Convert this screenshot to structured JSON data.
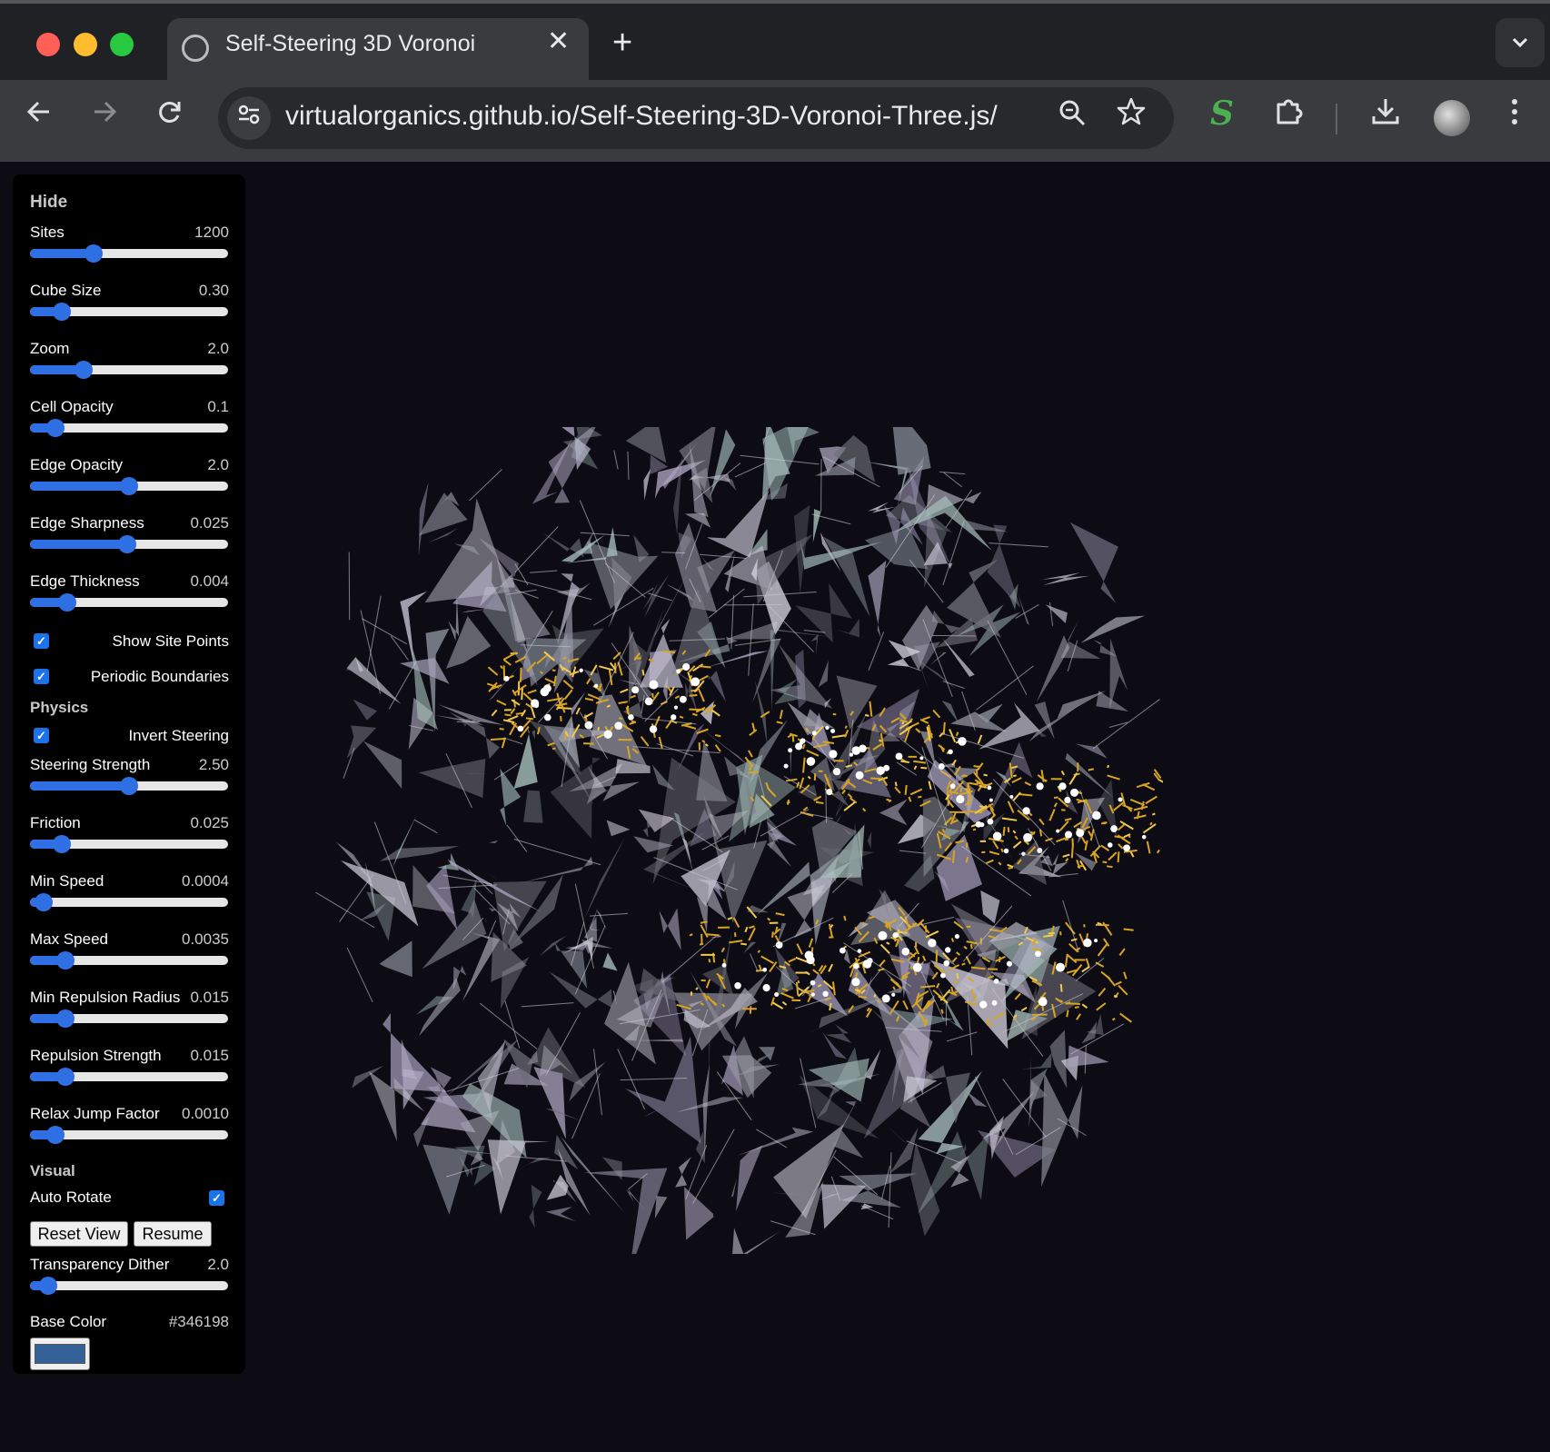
{
  "browser": {
    "tab_title": "Self-Steering 3D Voronoi",
    "tab_close": "✕",
    "new_tab": "+",
    "tab_menu": "⌄",
    "url": "virtualorganics.github.io/Self-Steering-3D-Voronoi-Three.js/",
    "extension_s": "S"
  },
  "panel": {
    "hide_label": "Hide",
    "sliders": [
      {
        "label": "Sites",
        "value": "1200",
        "fraction": 0.32
      },
      {
        "label": "Cube Size",
        "value": "0.30",
        "fraction": 0.16
      },
      {
        "label": "Zoom",
        "value": "2.0",
        "fraction": 0.27
      },
      {
        "label": "Cell Opacity",
        "value": "0.1",
        "fraction": 0.13
      },
      {
        "label": "Edge Opacity",
        "value": "2.0",
        "fraction": 0.5
      },
      {
        "label": "Edge Sharpness",
        "value": "0.025",
        "fraction": 0.49
      },
      {
        "label": "Edge Thickness",
        "value": "0.004",
        "fraction": 0.19
      }
    ],
    "show_site_points": "Show Site Points",
    "periodic_boundaries": "Periodic Boundaries",
    "physics_label": "Physics",
    "invert_steering": "Invert Steering",
    "physics_sliders": [
      {
        "label": "Steering Strength",
        "value": "2.50",
        "fraction": 0.5
      },
      {
        "label": "Friction",
        "value": "0.025",
        "fraction": 0.16
      },
      {
        "label": "Min Speed",
        "value": "0.0004",
        "fraction": 0.07
      },
      {
        "label": "Max Speed",
        "value": "0.0035",
        "fraction": 0.18
      },
      {
        "label": "Min Repulsion Radius",
        "value": "0.015",
        "fraction": 0.18
      },
      {
        "label": "Repulsion Strength",
        "value": "0.015",
        "fraction": 0.18
      },
      {
        "label": "Relax Jump Factor",
        "value": "0.0010",
        "fraction": 0.13
      }
    ],
    "visual_label": "Visual",
    "auto_rotate": "Auto Rotate",
    "reset_view": "Reset View",
    "resume": "Resume",
    "dither_slider": {
      "label": "Transparency Dither",
      "value": "2.0",
      "fraction": 0.09
    },
    "base_color_label": "Base Color",
    "base_color_value": "#346198",
    "accent_color": "#2f6fe4"
  }
}
